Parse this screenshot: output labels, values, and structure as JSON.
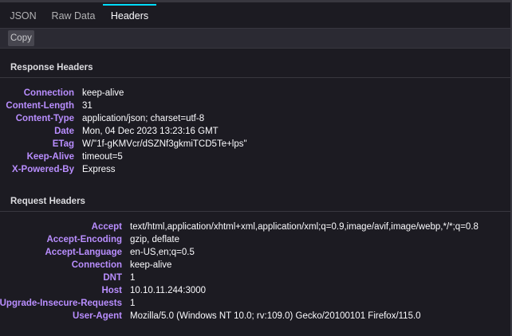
{
  "tabs": [
    "JSON",
    "Raw Data",
    "Headers"
  ],
  "active_tab": "Headers",
  "toolbar": {
    "copy_label": "Copy"
  },
  "response": {
    "title": "Response Headers",
    "headers": [
      {
        "name": "Connection",
        "value": "keep-alive"
      },
      {
        "name": "Content-Length",
        "value": "31"
      },
      {
        "name": "Content-Type",
        "value": "application/json; charset=utf-8"
      },
      {
        "name": "Date",
        "value": "Mon, 04 Dec 2023 13:23:16 GMT"
      },
      {
        "name": "ETag",
        "value": "W/\"1f-gKMVcr/dSZNf3gkmiTCD5Te+lps\""
      },
      {
        "name": "Keep-Alive",
        "value": "timeout=5"
      },
      {
        "name": "X-Powered-By",
        "value": "Express"
      }
    ]
  },
  "request": {
    "title": "Request Headers",
    "headers": [
      {
        "name": "Accept",
        "value": "text/html,application/xhtml+xml,application/xml;q=0.9,image/avif,image/webp,*/*;q=0.8"
      },
      {
        "name": "Accept-Encoding",
        "value": "gzip, deflate"
      },
      {
        "name": "Accept-Language",
        "value": "en-US,en;q=0.5"
      },
      {
        "name": "Connection",
        "value": "keep-alive"
      },
      {
        "name": "DNT",
        "value": "1"
      },
      {
        "name": "Host",
        "value": "10.10.11.244:3000"
      },
      {
        "name": "Upgrade-Insecure-Requests",
        "value": "1"
      },
      {
        "name": "User-Agent",
        "value": "Mozilla/5.0 (Windows NT 10.0; rv:109.0) Gecko/20100101 Firefox/115.0"
      }
    ]
  },
  "colors": {
    "background": "#1c1b22",
    "header_name": "#b98eff",
    "header_value": "#fbfbfe",
    "active_tab_indicator": "#00ddff"
  }
}
